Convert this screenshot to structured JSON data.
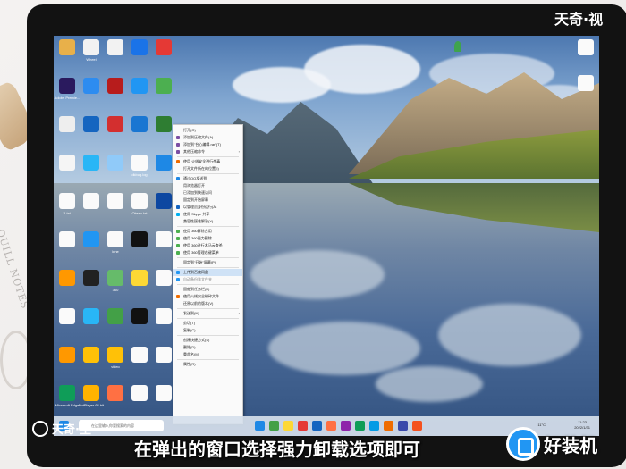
{
  "watermark_top": "天奇·视",
  "watermark_bottom_left": "天奇·生",
  "subtitle": "在弹出的窗口选择强力卸载选项即可",
  "brand_name": "好装机",
  "desktop_icons": [
    {
      "label": "",
      "color": "#e8b04a"
    },
    {
      "label": "Wheel",
      "color": "#f2f2f2"
    },
    {
      "label": "",
      "color": "#f2f2f2"
    },
    {
      "label": "",
      "color": "#1a73e8"
    },
    {
      "label": "",
      "color": "#e53935"
    },
    {
      "label": "Adobe Premie...",
      "color": "#2a1a5e"
    },
    {
      "label": "",
      "color": "#2d8cf0"
    },
    {
      "label": "",
      "color": "#b71c1c"
    },
    {
      "label": "",
      "color": "#2196f3"
    },
    {
      "label": "",
      "color": "#4caf50"
    },
    {
      "label": "",
      "color": "#eeeeee"
    },
    {
      "label": "",
      "color": "#1565c0"
    },
    {
      "label": "",
      "color": "#d32f2f"
    },
    {
      "label": "",
      "color": "#1976d2"
    },
    {
      "label": "",
      "color": "#2e7d32"
    },
    {
      "label": "",
      "color": "#f5f5f5"
    },
    {
      "label": "",
      "color": "#29b6f6"
    },
    {
      "label": "",
      "color": "#90caf9"
    },
    {
      "label": "dkbug.log",
      "color": "#fafafa"
    },
    {
      "label": "",
      "color": "#1e88e5"
    },
    {
      "label": "1.txt",
      "color": "#fafafa"
    },
    {
      "label": "",
      "color": "#fafafa"
    },
    {
      "label": "",
      "color": "#fafafa"
    },
    {
      "label": "Obsec.txt",
      "color": "#fafafa"
    },
    {
      "label": "",
      "color": "#0d47a1"
    },
    {
      "label": "",
      "color": "#fafafa"
    },
    {
      "label": "",
      "color": "#2196f3"
    },
    {
      "label": "lene",
      "color": "#fafafa"
    },
    {
      "label": "",
      "color": "#111111"
    },
    {
      "label": "",
      "color": "#fafafa"
    },
    {
      "label": "",
      "color": "#ff9800"
    },
    {
      "label": "",
      "color": "#212121"
    },
    {
      "label": "360",
      "color": "#66bb6a"
    },
    {
      "label": "",
      "color": "#fdd835"
    },
    {
      "label": "",
      "color": "#fafafa"
    },
    {
      "label": "",
      "color": "#fafafa"
    },
    {
      "label": "",
      "color": "#29b6f6"
    },
    {
      "label": "",
      "color": "#43a047"
    },
    {
      "label": "",
      "color": "#111111"
    },
    {
      "label": "",
      "color": "#fafafa"
    },
    {
      "label": "",
      "color": "#ff9800"
    },
    {
      "label": "",
      "color": "#ffc107"
    },
    {
      "label": "video",
      "color": "#ffc107"
    },
    {
      "label": "",
      "color": "#fafafa"
    },
    {
      "label": "",
      "color": "#fafafa"
    },
    {
      "label": "Microsoft Edge",
      "color": "#0f9d58"
    },
    {
      "label": "PotPlayer 64 bit",
      "color": "#ffb300"
    },
    {
      "label": "",
      "color": "#ff7043"
    },
    {
      "label": "",
      "color": "#fafafa"
    },
    {
      "label": "",
      "color": "#fafafa"
    }
  ],
  "context_menu": [
    {
      "label": "打开(O)",
      "icon": "none",
      "hl": false
    },
    {
      "label": "添加到压缩文件(A)...",
      "icon": "archive",
      "hl": false
    },
    {
      "label": "添加到\"台心编辑.rar\"(T)",
      "icon": "archive",
      "hl": false
    },
    {
      "label": "其他压缩命令",
      "icon": "archive",
      "hl": false,
      "sub": true
    },
    {
      "sep": true
    },
    {
      "label": "使用 火绒安全进行杀毒",
      "icon": "shield",
      "hl": false
    },
    {
      "label": "打开文件所在的位置(I)",
      "icon": "none",
      "hl": false
    },
    {
      "sep": true
    },
    {
      "label": "通过QQ发送到",
      "icon": "qq",
      "hl": false
    },
    {
      "label": "用浏览器打开",
      "icon": "none",
      "hl": false
    },
    {
      "label": "已添加到快速访问",
      "icon": "none",
      "hl": false
    },
    {
      "label": "固定到开始屏幕",
      "icon": "none",
      "hl": false
    },
    {
      "label": "以管理员身份运行(A)",
      "icon": "admin",
      "hl": false
    },
    {
      "label": "使用 Skype 共享",
      "icon": "skype",
      "hl": false
    },
    {
      "label": "兼容性疑难解答(Y)",
      "icon": "none",
      "hl": false
    },
    {
      "sep": true
    },
    {
      "label": "使用 360解除占用",
      "icon": "360",
      "hl": false
    },
    {
      "label": "使用 360强力删除",
      "icon": "360",
      "hl": false
    },
    {
      "label": "使用 360进行木马云查杀",
      "icon": "360",
      "hl": false
    },
    {
      "label": "使用 360管理右键菜单",
      "icon": "360",
      "hl": false
    },
    {
      "sep": true
    },
    {
      "label": "固定到\"开始\"屏幕(P)",
      "icon": "none",
      "hl": false
    },
    {
      "sep": true
    },
    {
      "label": "上传到百度网盘",
      "icon": "baidu",
      "hl": true
    },
    {
      "label": "自动备份该文件夹",
      "icon": "baidu",
      "hl": false,
      "dim": true
    },
    {
      "sep": true
    },
    {
      "label": "固定到任务栏(K)",
      "icon": "none",
      "hl": false
    },
    {
      "label": "使用火绒安全粉碎文件",
      "icon": "shield",
      "hl": false
    },
    {
      "label": "还原以前的版本(V)",
      "icon": "none",
      "hl": false
    },
    {
      "sep": true
    },
    {
      "label": "发送到(N)",
      "icon": "none",
      "hl": false,
      "sub": true
    },
    {
      "sep": true
    },
    {
      "label": "剪切(T)",
      "icon": "none",
      "hl": false
    },
    {
      "label": "复制(C)",
      "icon": "none",
      "hl": false
    },
    {
      "sep": true
    },
    {
      "label": "创建快捷方式(S)",
      "icon": "none",
      "hl": false
    },
    {
      "label": "删除(D)",
      "icon": "none",
      "hl": false
    },
    {
      "label": "重命名(M)",
      "icon": "none",
      "hl": false
    },
    {
      "sep": true
    },
    {
      "label": "属性(R)",
      "icon": "none",
      "hl": false
    }
  ],
  "taskbar": {
    "search_placeholder": "在这里输入你要搜索的内容",
    "apps": [
      "#1e88e5",
      "#43a047",
      "#fdd835",
      "#e53935",
      "#1565c0",
      "#ff7043",
      "#8e24aa",
      "#0f9d58",
      "#039be5",
      "#ef6c00",
      "#3949ab",
      "#f4511e"
    ],
    "weather": "11°C",
    "time": "11:23",
    "date": "2022/1/31"
  },
  "colors": {
    "highlight": "#cfe2f6",
    "taskbar": "#d6e0ec",
    "brand": "#2196f3"
  }
}
